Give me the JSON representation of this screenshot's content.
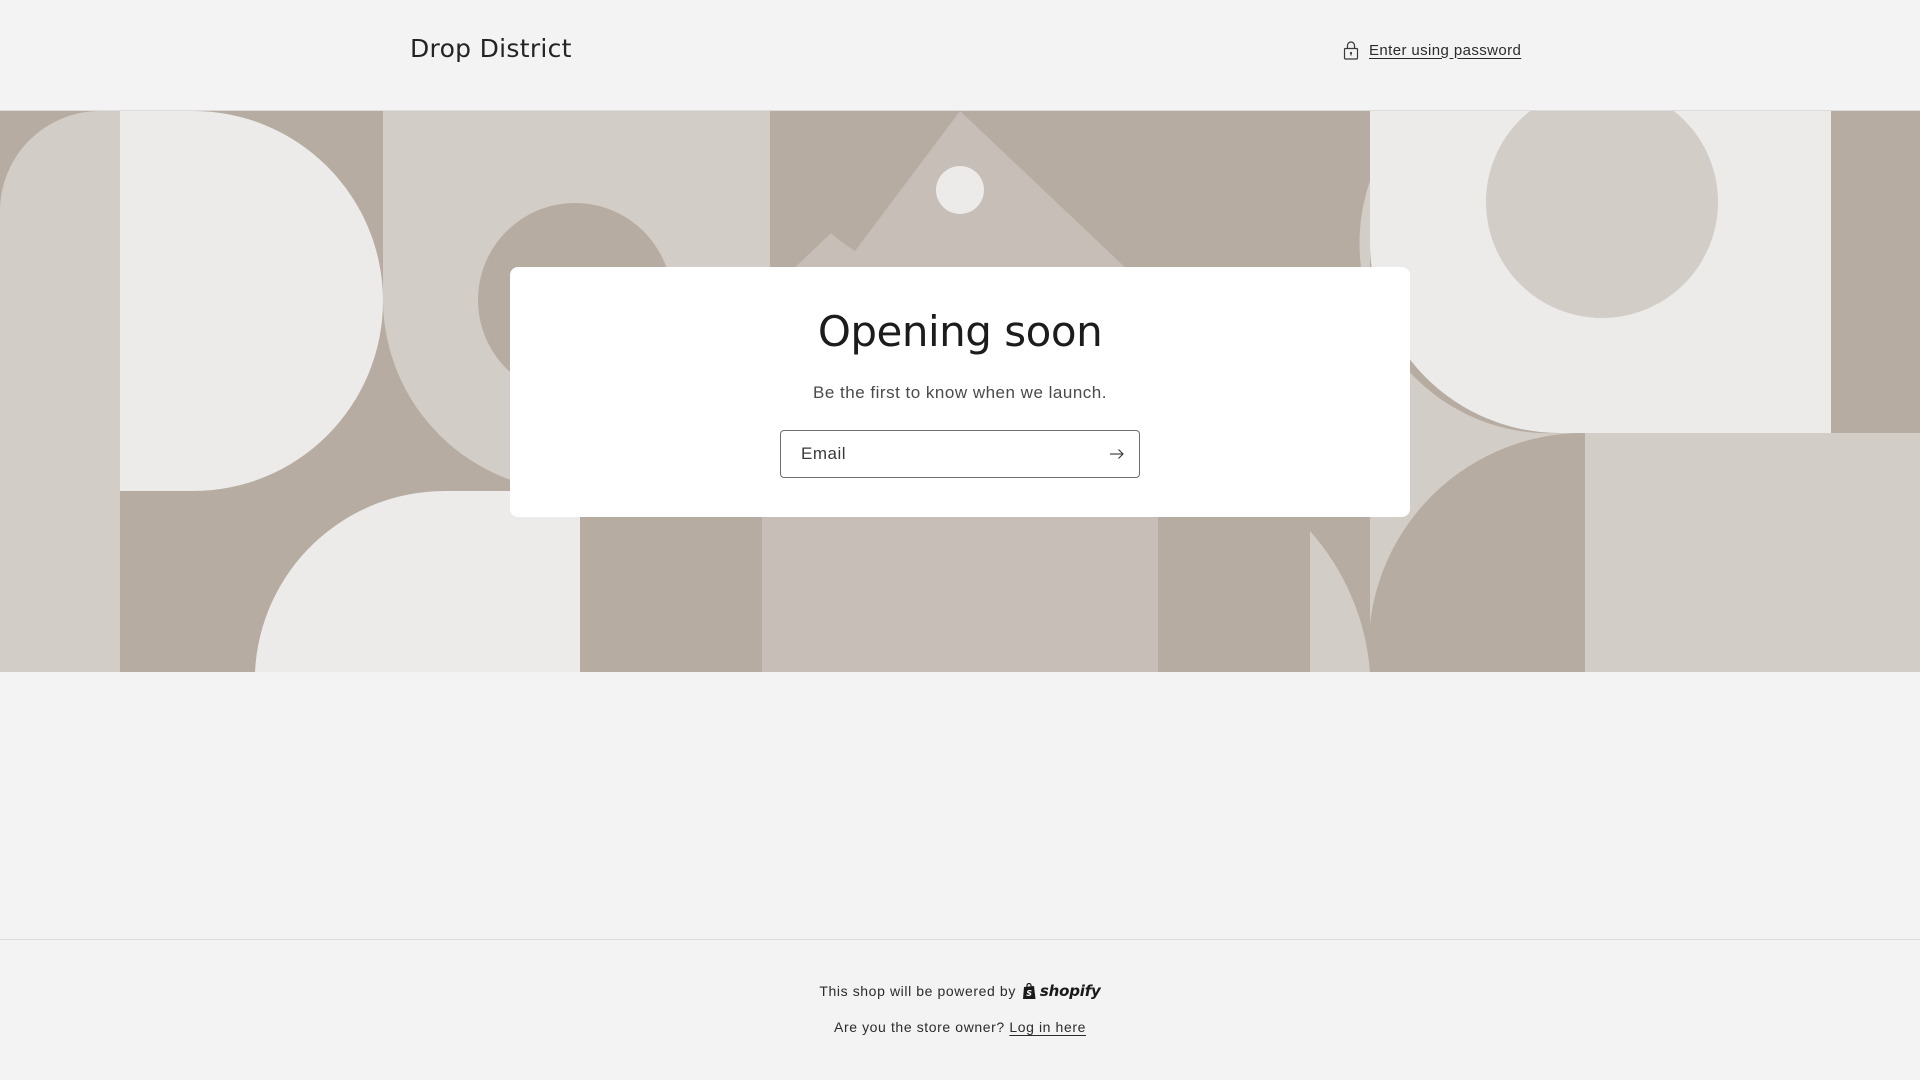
{
  "header": {
    "store_name": "Drop District",
    "password_link": "Enter using password",
    "lock_icon": "lock-icon"
  },
  "banner": {
    "description_icon": "decorative-geometric-banner",
    "colors": {
      "dark": "#b6aca1",
      "medium": "#d2cdc6",
      "light": "#ecebe9",
      "tag": "#c7beb7"
    }
  },
  "card": {
    "title": "Opening soon",
    "subtitle": "Be the first to know when we launch.",
    "email_placeholder": "Email",
    "submit_icon": "arrow-right-icon"
  },
  "footer": {
    "powered_text": "This shop will be powered by",
    "shopify_wordmark": "shopify",
    "owner_text": "Are you the store owner?",
    "login_link": "Log in here"
  },
  "colors": {
    "page_bg": "#f3f3f3",
    "card_bg": "#ffffff",
    "text": "#121212"
  }
}
